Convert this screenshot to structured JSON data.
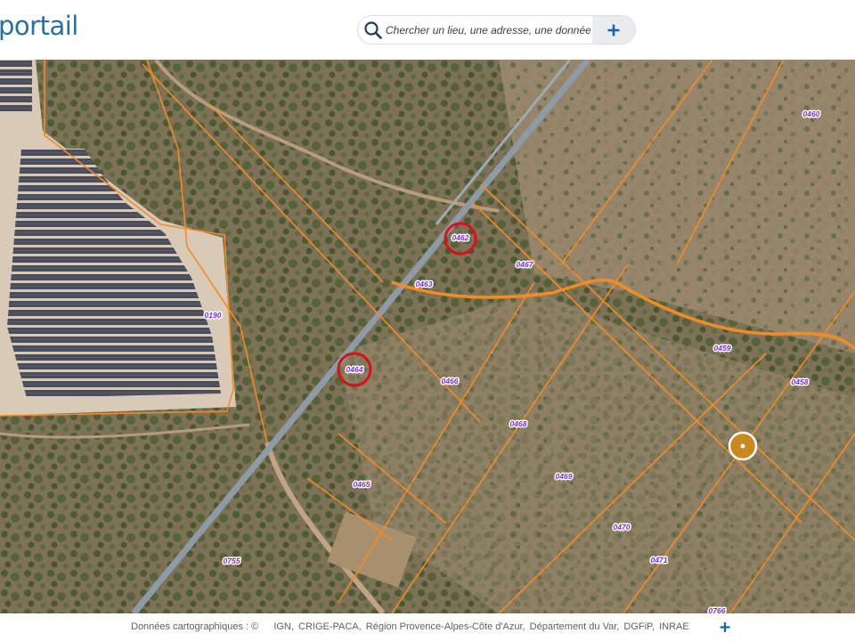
{
  "header": {
    "logo_text": "portail",
    "search": {
      "placeholder": "Chercher un lieu, une adresse, une donnée"
    }
  },
  "map": {
    "parcel_labels": [
      "0460",
      "0462",
      "0467",
      "0463",
      "0190",
      "0459",
      "0458",
      "0464",
      "0466",
      "0468",
      "0465",
      "0469",
      "0470",
      "0755",
      "0471",
      "0766"
    ],
    "highlighted_parcels": [
      "0462",
      "0464"
    ],
    "colors": {
      "parcel_border": "#f28c28",
      "label_text": "#7a2fd0",
      "highlight_circle": "#d9101a",
      "location_marker": "#c88a1e",
      "power_line": "#8e9ba6"
    }
  },
  "footer": {
    "attribution_prefix": "Données cartographiques : ©",
    "attribution_sources": [
      "IGN,",
      "CRIGE-PACA,",
      "Région Provence-Alpes-Côte d'Azur,",
      "Département du Var,",
      "DGFiP,",
      "INRAE"
    ]
  }
}
